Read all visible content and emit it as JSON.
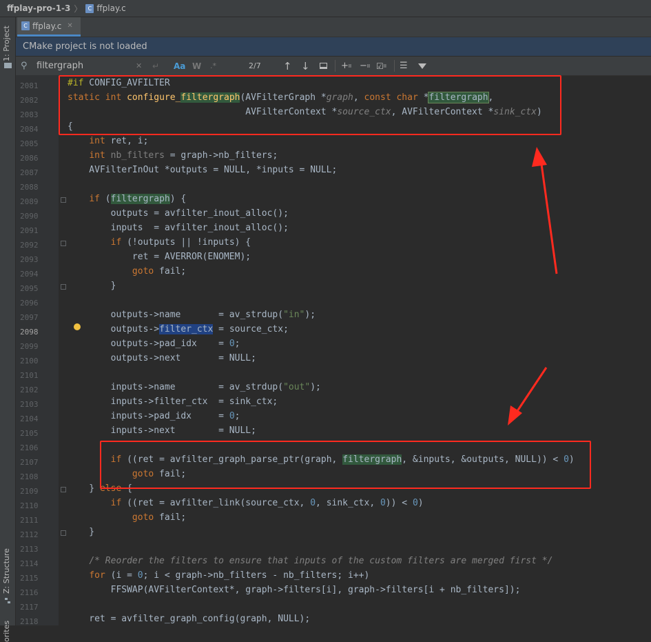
{
  "breadcrumb": {
    "project": "ffplay-pro-1-3",
    "file": "ffplay.c",
    "file_icon": "C"
  },
  "side_panels": {
    "project": "1: Project",
    "structure": "Z: Structure",
    "favorites": "orites"
  },
  "tab": {
    "label": "ffplay.c",
    "icon": "C"
  },
  "banner": {
    "text": "CMake project is not loaded"
  },
  "search": {
    "query": "filtergraph",
    "match_case": "Aa",
    "words": "W",
    "regex": ".*",
    "count": "2/7"
  },
  "line_numbers": [
    "2081",
    "2082",
    "2083",
    "2084",
    "2085",
    "2086",
    "2087",
    "2088",
    "2089",
    "2090",
    "2091",
    "2092",
    "2093",
    "2094",
    "2095",
    "2096",
    "2097",
    "2098",
    "2099",
    "2100",
    "2101",
    "2102",
    "2103",
    "2104",
    "2105",
    "2106",
    "2107",
    "2108",
    "2109",
    "2110",
    "2111",
    "2112",
    "2113",
    "2114",
    "2115",
    "2116",
    "2117",
    "2118"
  ],
  "current_line": "2098",
  "code_lines": [
    "#if CONFIG_AVFILTER",
    "static int configure_filtergraph(AVFilterGraph *graph, const char *filtergraph,",
    "                                 AVFilterContext *source_ctx, AVFilterContext *sink_ctx)",
    "{",
    "    int ret, i;",
    "    int nb_filters = graph->nb_filters;",
    "    AVFilterInOut *outputs = NULL, *inputs = NULL;",
    "",
    "    if (filtergraph) {",
    "        outputs = avfilter_inout_alloc();",
    "        inputs  = avfilter_inout_alloc();",
    "        if (!outputs || !inputs) {",
    "            ret = AVERROR(ENOMEM);",
    "            goto fail;",
    "        }",
    "",
    "        outputs->name       = av_strdup(\"in\");",
    "        outputs->filter_ctx = source_ctx;",
    "        outputs->pad_idx    = 0;",
    "        outputs->next       = NULL;",
    "",
    "        inputs->name        = av_strdup(\"out\");",
    "        inputs->filter_ctx  = sink_ctx;",
    "        inputs->pad_idx     = 0;",
    "        inputs->next        = NULL;",
    "",
    "        if ((ret = avfilter_graph_parse_ptr(graph, filtergraph, &inputs, &outputs, NULL)) < 0)",
    "            goto fail;",
    "    } else {",
    "        if ((ret = avfilter_link(source_ctx, 0, sink_ctx, 0)) < 0)",
    "            goto fail;",
    "    }",
    "",
    "    /* Reorder the filters to ensure that inputs of the custom filters are merged first */",
    "    for (i = 0; i < graph->nb_filters - nb_filters; i++)",
    "        FFSWAP(AVFilterContext*, graph->filters[i], graph->filters[i + nb_filters]);",
    "",
    "    ret = avfilter_graph_config(graph, NULL);"
  ],
  "colors": {
    "editor_bg": "#2b2b2b",
    "keyword": "#cc7832",
    "function": "#ffc66d",
    "search_highlight": "#32593d",
    "annotation_red": "#ff2a1f"
  }
}
